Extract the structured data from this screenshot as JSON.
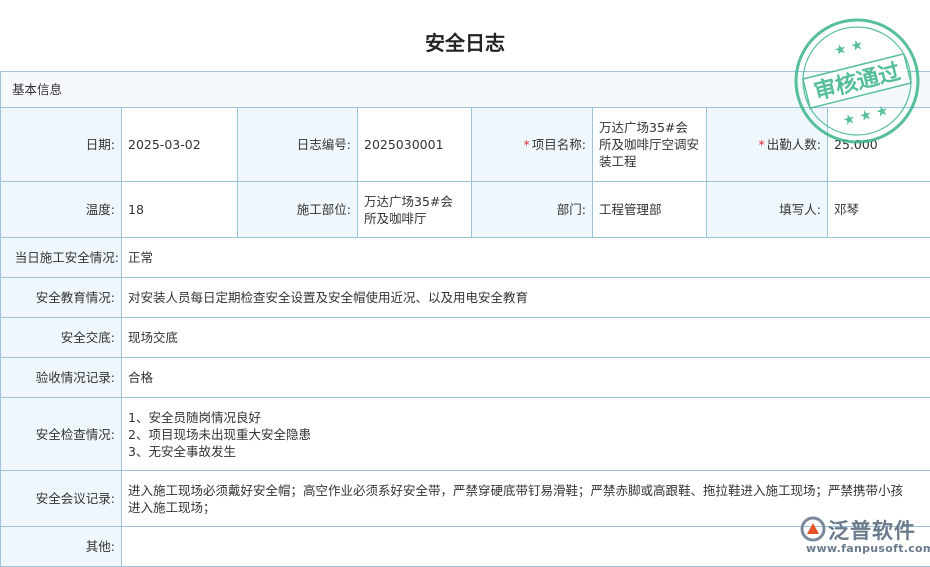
{
  "title": "安全日志",
  "section_title": "基本信息",
  "fields": {
    "date": {
      "label": "日期:",
      "value": "2025-03-02"
    },
    "log_no": {
      "label": "日志编号:",
      "value": "2025030001"
    },
    "project": {
      "label": "项目名称:",
      "value": "万达广场35#会所及咖啡厅空调安装工程",
      "required_mark": "*"
    },
    "attendance": {
      "label": "出勤人数:",
      "value": "25.000",
      "required_mark": "*"
    },
    "temperature": {
      "label": "温度:",
      "value": "18"
    },
    "site": {
      "label": "施工部位:",
      "value": "万达广场35#会所及咖啡厅"
    },
    "dept": {
      "label": "部门:",
      "value": "工程管理部"
    },
    "filler": {
      "label": "填写人:",
      "value": "邓琴"
    },
    "daily_safety": {
      "label": "当日施工安全情况:",
      "value": "正常"
    },
    "safety_edu": {
      "label": "安全教育情况:",
      "value": "对安装人员每日定期检查安全设置及安全帽使用近况、以及用电安全教育"
    },
    "safety_brief": {
      "label": "安全交底:",
      "value": "现场交底"
    },
    "acceptance": {
      "label": "验收情况记录:",
      "value": "合格"
    },
    "safety_check": {
      "label": "安全检查情况:",
      "lines": [
        "1、安全员随岗情况良好",
        "2、项目现场未出现重大安全隐患",
        "3、无安全事故发生"
      ]
    },
    "safety_meeting": {
      "label": "安全会议记录:",
      "lines": [
        "进入施工现场必须戴好安全帽；高空作业必须系好安全带，严禁穿硬底带钉易滑鞋；严禁赤脚或高跟鞋、拖拉鞋进入施工现场；严禁携带小孩",
        "进入施工现场；"
      ]
    },
    "other": {
      "label": "其他:",
      "value": ""
    }
  },
  "stamp": {
    "text": "审核通过",
    "color": "#3bb58a"
  },
  "logo": {
    "name": "泛普软件",
    "url": "www.fanpusoft.com"
  }
}
